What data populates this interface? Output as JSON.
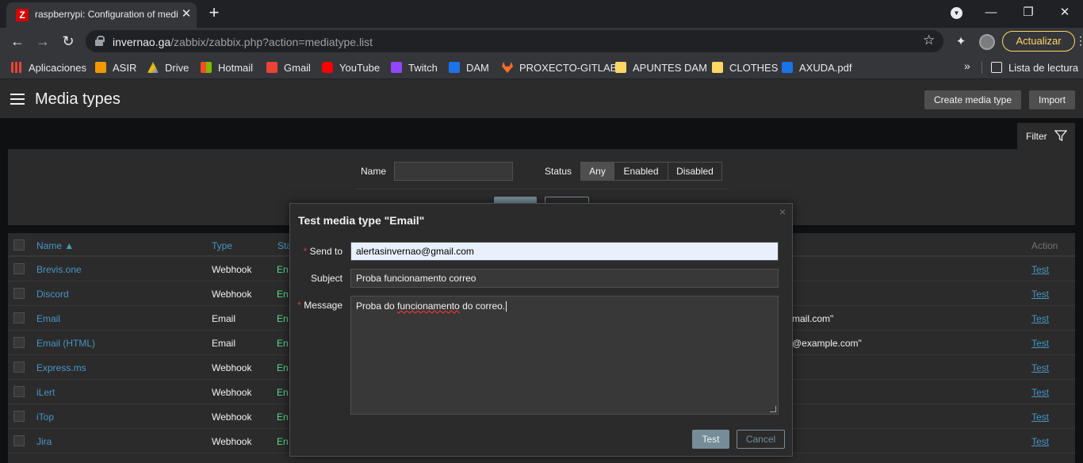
{
  "browser": {
    "tab_title": "raspberrypi: Configuration of media types",
    "tab_favicon_letter": "Z",
    "url_host": "invernao.ga",
    "url_path": "/zabbix/zabbix.php?action=mediatype.list",
    "update_label": "Actualizar",
    "bookmarks": [
      {
        "label": "Aplicaciones",
        "color": "#ea4335"
      },
      {
        "label": "ASIR",
        "color": "#f29900"
      },
      {
        "label": "Drive",
        "color": "#34a853"
      },
      {
        "label": "Hotmail",
        "color": "#f25022"
      },
      {
        "label": "Gmail",
        "color": "#ea4335"
      },
      {
        "label": "YouTube",
        "color": "#ff0000"
      },
      {
        "label": "Twitch",
        "color": "#9146ff"
      },
      {
        "label": "DAM",
        "color": "#1a73e8"
      },
      {
        "label": "PROXECTO-GITLAB",
        "color": "#fc6d26"
      },
      {
        "label": "APUNTES DAM",
        "color": "#fdd663"
      },
      {
        "label": "CLOTHES",
        "color": "#fdd663"
      },
      {
        "label": "AXUDA.pdf",
        "color": "#1a73e8"
      }
    ],
    "reading_list_label": "Lista de lectura"
  },
  "header": {
    "title": "Media types",
    "create_button": "Create media type",
    "import_button": "Import"
  },
  "filter": {
    "tab_label": "Filter",
    "name_label": "Name",
    "name_value": "",
    "status_label": "Status",
    "status_options": [
      "Any",
      "Enabled",
      "Disabled"
    ],
    "status_selected": "Any"
  },
  "table": {
    "columns": {
      "name": "Name ▲",
      "type": "Type",
      "status": "Sta",
      "action": "Action"
    },
    "rows": [
      {
        "name": "Brevis.one",
        "type": "Webhook",
        "status": "En",
        "details": "",
        "action": "Test"
      },
      {
        "name": "Discord",
        "type": "Webhook",
        "status": "En",
        "details": "",
        "action": "Test"
      },
      {
        "name": "Email",
        "type": "Email",
        "status": "En",
        "details": "mail.com\"",
        "action": "Test"
      },
      {
        "name": "Email (HTML)",
        "type": "Email",
        "status": "En",
        "details": "@example.com\"",
        "action": "Test"
      },
      {
        "name": "Express.ms",
        "type": "Webhook",
        "status": "En",
        "details": "",
        "action": "Test"
      },
      {
        "name": "iLert",
        "type": "Webhook",
        "status": "En",
        "details": "",
        "action": "Test"
      },
      {
        "name": "iTop",
        "type": "Webhook",
        "status": "En",
        "details": "",
        "action": "Test"
      },
      {
        "name": "Jira",
        "type": "Webhook",
        "status": "En",
        "details": "",
        "action": "Test"
      }
    ]
  },
  "modal": {
    "title": "Test media type \"Email\"",
    "close": "×",
    "send_to_label": "Send to",
    "send_to_value": "alertasinvernao@gmail.com",
    "subject_label": "Subject",
    "subject_value": "Proba funcionamento correo",
    "message_label": "Message",
    "message_before": "Proba do ",
    "message_misspelled": "funcionamento",
    "message_after": " do correo.",
    "required_mark": "*",
    "test_button": "Test",
    "cancel_button": "Cancel"
  }
}
